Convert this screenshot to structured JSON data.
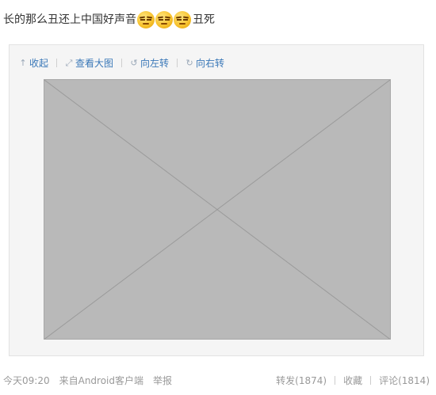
{
  "post": {
    "text_before": "长的那么丑还上中国好声音",
    "emojis": [
      "neutral-face-icon",
      "neutral-face-icon",
      "neutral-face-icon"
    ],
    "text_after": "丑死"
  },
  "toolbar": {
    "collapse_label": "收起",
    "view_large_label": "查看大图",
    "rotate_left_label": "向左转",
    "rotate_right_label": "向右转"
  },
  "photo": {},
  "footer": {
    "time": "今天09:20",
    "source_prefix": "来自",
    "source": "Android客户端",
    "report": "举报",
    "repost": "转发(1874)",
    "favorite": "收藏",
    "comment": "评论(1814)"
  },
  "colors": {
    "link": "#3a78b8",
    "muted": "#999999",
    "card_bg": "#f5f5f5"
  }
}
